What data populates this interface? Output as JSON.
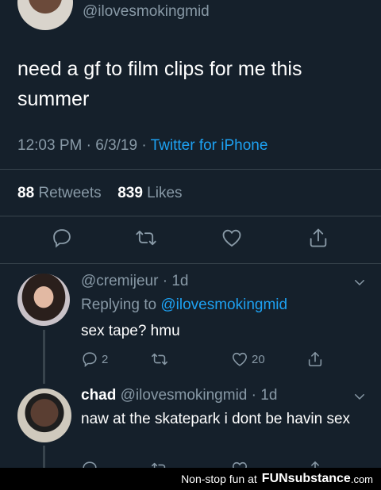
{
  "main_tweet": {
    "handle": "@ilovesmokingmid",
    "text": "need a gf to film clips for me this summer",
    "time": "12:03 PM",
    "date": "6/3/19",
    "source": "Twitter for iPhone",
    "retweets_count": "88",
    "retweets_label": "Retweets",
    "likes_count": "839",
    "likes_label": "Likes",
    "actions": [
      "reply-icon",
      "retweet-icon",
      "like-icon",
      "share-icon"
    ]
  },
  "replies": [
    {
      "handle": "@cremijeur",
      "age": "1d",
      "replying_label": "Replying to",
      "replying_to": "@ilovesmokingmid",
      "text": "sex tape? hmu",
      "reply_count": "2",
      "like_count": "20"
    },
    {
      "name": "chad",
      "handle": "@ilovesmokingmid",
      "age": "1d",
      "text": "naw at the skatepark i dont be havin sex"
    }
  ],
  "watermark": {
    "text": "Non-stop fun at",
    "brand": "FUNsubstance",
    "domain": ".com"
  },
  "colors": {
    "background": "#15202b",
    "text": "#ffffff",
    "secondary": "#8899a6",
    "link": "#1da1f2",
    "divider": "#38444d"
  }
}
